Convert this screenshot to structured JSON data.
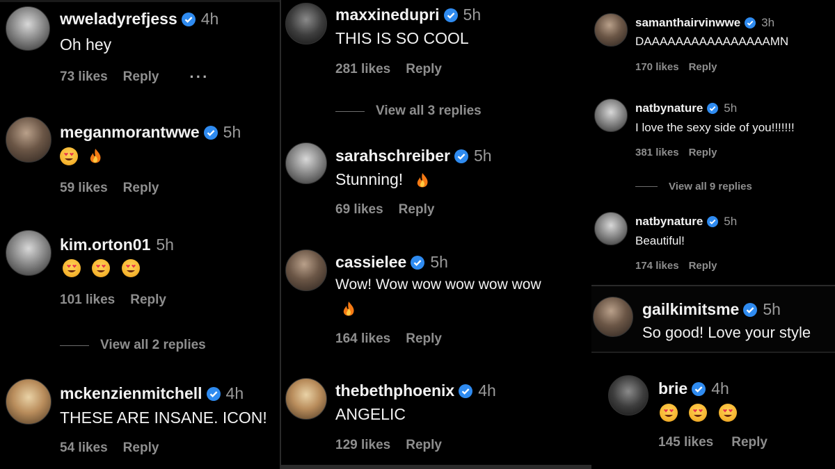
{
  "col1": {
    "comments": [
      {
        "username": "wweladyrefjess",
        "time": "4h",
        "text": "Oh hey",
        "likes": "73 likes",
        "reply": "Reply",
        "more": "···"
      },
      {
        "username": "meganmorantwwe",
        "time": "5h",
        "emojis": [
          "heart-eyes-emoji",
          "fire-emoji"
        ],
        "likes": "59 likes",
        "reply": "Reply"
      },
      {
        "username": "kim.orton01",
        "time": "5h",
        "emojis": [
          "heart-eyes-emoji",
          "heart-eyes-emoji",
          "heart-eyes-emoji"
        ],
        "likes": "101 likes",
        "reply": "Reply",
        "view_replies": "View all 2 replies"
      },
      {
        "username": "mckenzienmitchell",
        "time": "4h",
        "text": "THESE ARE INSANE. ICON!",
        "likes": "54 likes",
        "reply": "Reply"
      }
    ]
  },
  "col2": {
    "comments": [
      {
        "username": "maxxinedupri",
        "time": "5h",
        "text": "THIS IS SO COOL",
        "likes": "281 likes",
        "reply": "Reply",
        "view_replies": "View all 3 replies"
      },
      {
        "username": "sarahschreiber",
        "time": "5h",
        "text": "Stunning!",
        "emojis": [
          "fire-emoji"
        ],
        "likes": "69 likes",
        "reply": "Reply"
      },
      {
        "username": "cassielee",
        "time": "5h",
        "text": "Wow! Wow wow wow wow wow",
        "emojis": [
          "fire-emoji"
        ],
        "likes": "164 likes",
        "reply": "Reply"
      },
      {
        "username": "thebethphoenix",
        "time": "4h",
        "text": "ANGELIC",
        "likes": "129 likes",
        "reply": "Reply"
      }
    ]
  },
  "col3": {
    "comments": [
      {
        "username": "samanthairvinwwe",
        "time": "3h",
        "text": "DAAAAAAAAAAAAAAAAMN",
        "likes": "170 likes",
        "reply": "Reply"
      },
      {
        "username": "natbynature",
        "time": "5h",
        "text": "I love the sexy side of you!!!!!!!",
        "likes": "381 likes",
        "reply": "Reply",
        "view_replies": "View all 9 replies"
      },
      {
        "username": "natbynature",
        "time": "5h",
        "text": "Beautiful!",
        "likes": "174 likes",
        "reply": "Reply"
      }
    ]
  },
  "col3b": {
    "comments": [
      {
        "username": "gailkimitsme",
        "time": "5h",
        "text": "So good! Love your style"
      }
    ]
  },
  "col3c": {
    "comments": [
      {
        "username": "brie",
        "time": "4h",
        "emojis": [
          "heart-eyes-emoji",
          "heart-eyes-emoji",
          "heart-eyes-emoji"
        ],
        "likes": "145 likes",
        "reply": "Reply"
      }
    ]
  },
  "colors": {
    "background": "#000000",
    "verified": "#2f8bf0",
    "muted": "#8e8e8e",
    "text": "#f2f2f2"
  }
}
